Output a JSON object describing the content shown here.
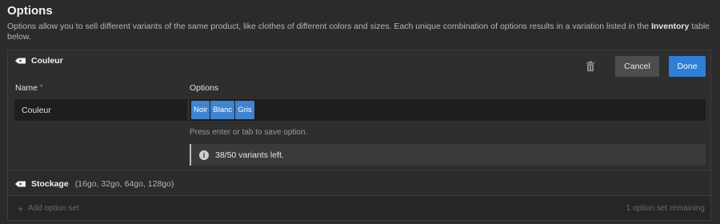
{
  "header": {
    "title": "Options",
    "description_before": "Options allow you to sell different variants of the same product, like clothes of different colors and sizes. Each unique combination of options results in a variation listed in the ",
    "description_bold": "Inventory",
    "description_after": " table below."
  },
  "option_set": {
    "title": "Couleur",
    "tag_icon": "tag-icon",
    "trash_icon": "trash-icon",
    "cancel_label": "Cancel",
    "done_label": "Done",
    "name_label": "Name",
    "name_required_mark": "*",
    "options_label": "Options",
    "name_value": "Couleur",
    "option_values": [
      "Noir",
      "Blanc",
      "Gris"
    ],
    "hint": "Press enter or tab to save option.",
    "info_icon": "info-icon",
    "info_text": "38/50 variants left.",
    "accent_color": "#2f7fd6"
  },
  "stock_set": {
    "title": "Stockage",
    "values": "(16go, 32go, 64go, 128go)"
  },
  "footer": {
    "add_label": "Add option set",
    "remaining": "1 option set remaining"
  }
}
